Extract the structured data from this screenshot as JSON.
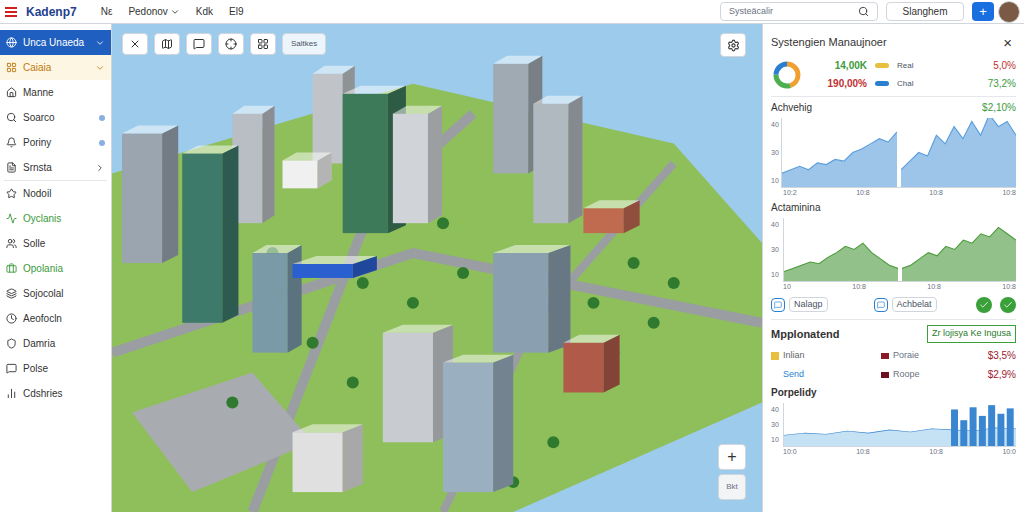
{
  "topbar": {
    "logo": "Kadenp7",
    "menus": [
      {
        "label": "Nε",
        "dropdown": false
      },
      {
        "label": "Pedonov",
        "dropdown": true
      },
      {
        "label": "Kdk",
        "dropdown": false
      },
      {
        "label": "El9",
        "dropdown": false
      }
    ],
    "search": {
      "placeholder": "Systeäcalir"
    },
    "button": "Slanghem",
    "add": "+"
  },
  "sidebar": {
    "items": [
      {
        "label": "Unca Unaeda",
        "selected": true,
        "color": "#ffffff",
        "trailing": "chevron-down",
        "divider_before": false
      },
      {
        "label": "Caiaia",
        "selected": false,
        "color": "#c07a10",
        "trailing": "chevron-down",
        "divider_before": false
      },
      {
        "label": "Manne",
        "selected": false,
        "color": "#333333",
        "trailing": "none",
        "divider_before": false
      },
      {
        "label": "Soarco",
        "selected": false,
        "color": "#333333",
        "trailing": "dot",
        "divider_before": false
      },
      {
        "label": "Poriny",
        "selected": false,
        "color": "#333333",
        "trailing": "dot",
        "divider_before": false
      },
      {
        "label": "Srnsta",
        "selected": false,
        "color": "#333333",
        "trailing": "chevron-right",
        "divider_before": false
      },
      {
        "label": "Nodoil",
        "selected": false,
        "color": "#333333",
        "trailing": "none",
        "divider_before": true
      },
      {
        "label": "Oyclanis",
        "selected": false,
        "color": "#3a9a3a",
        "trailing": "none",
        "divider_before": false
      },
      {
        "label": "Solle",
        "selected": false,
        "color": "#333333",
        "trailing": "none",
        "divider_before": false
      },
      {
        "label": "Opolania",
        "selected": false,
        "color": "#3a9a3a",
        "trailing": "none",
        "divider_before": false
      },
      {
        "label": "Sojocolal",
        "selected": false,
        "color": "#333333",
        "trailing": "none",
        "divider_before": false
      },
      {
        "label": "Aeofocln",
        "selected": false,
        "color": "#333333",
        "trailing": "none",
        "divider_before": false
      },
      {
        "label": "Damria",
        "selected": false,
        "color": "#333333",
        "trailing": "none",
        "divider_before": false
      },
      {
        "label": "Polse",
        "selected": false,
        "color": "#333333",
        "trailing": "none",
        "divider_before": false
      },
      {
        "label": "Cdshries",
        "selected": false,
        "color": "#333333",
        "trailing": "none",
        "divider_before": false
      }
    ]
  },
  "map": {
    "toolbar_button": "Saltkes",
    "zoom_in": "+",
    "bottom_button": "Bkt"
  },
  "panel": {
    "title": "Systengien Manaujnoer",
    "close": "×",
    "donut": [
      {
        "value": 45,
        "color": "#f0a030"
      },
      {
        "value": 30,
        "color": "#4caf50"
      },
      {
        "value": 25,
        "color": "#2a7fd0"
      }
    ],
    "stats": [
      {
        "value": "14,00K",
        "value_color": "#3c9b3c",
        "swatch": "#e8c040",
        "label": "Real",
        "change": "5,0%",
        "change_color": "#c03030"
      },
      {
        "value": "190,00%",
        "value_color": "#c03030",
        "swatch": "#2a7fd0",
        "label": "Chal",
        "change": "73,2%",
        "change_color": "#3c9b3c"
      }
    ],
    "chart1": {
      "title": "Achvehig",
      "value": "$2,10%",
      "y_ticks": [
        "40",
        "30",
        "10"
      ],
      "x_ticks": [
        "10:2",
        "10:8",
        "10:8",
        "10:8"
      ],
      "color": "#5b9fdc",
      "max": 40,
      "panels": [
        [
          8,
          10,
          12,
          10,
          14,
          13,
          16,
          15,
          20,
          22,
          25,
          28,
          26,
          32
        ],
        [
          10,
          15,
          20,
          18,
          30,
          25,
          35,
          28,
          38,
          30,
          42,
          35,
          38,
          30
        ]
      ]
    },
    "chart2": {
      "title": "Actaminina",
      "y_ticks": [
        "40",
        "30",
        "10"
      ],
      "x_ticks": [
        "10",
        "10:8",
        "10:8",
        "10:8"
      ],
      "color": "#4a9a3a",
      "max": 40,
      "panels": [
        [
          6,
          8,
          10,
          12,
          11,
          15,
          18,
          22,
          20,
          24,
          18,
          14,
          10,
          8
        ],
        [
          8,
          10,
          14,
          18,
          16,
          22,
          20,
          26,
          24,
          30,
          28,
          34,
          30,
          26
        ]
      ]
    },
    "actions": [
      {
        "label": "Nalagp"
      },
      {
        "label": "Achbelat"
      }
    ],
    "checks": 2,
    "section": {
      "title": "Mpplonatend",
      "badge": "Zr lojisya Ke Ingusa"
    },
    "legend": [
      {
        "left_label": "Inlian",
        "left_color": "#e8c040",
        "left_swatch": true,
        "right_label": "Poraie",
        "right_color": "#8b1a2a",
        "value": "$3,5%"
      },
      {
        "left_label": "Send",
        "left_color": "#2a7fd0",
        "left_swatch": false,
        "right_label": "Roope",
        "right_color": "#6b1020",
        "value": "$2,9%"
      }
    ],
    "chart3": {
      "title": "Porpelidy",
      "y_ticks": [
        "40",
        "30",
        "10"
      ],
      "x_ticks": [
        "10:0",
        "10:8",
        "10:8",
        "10:0"
      ],
      "color": "#8cc4ea",
      "bar_color": "#3a86d0",
      "max": 40,
      "line": [
        10,
        12,
        11,
        14,
        12,
        15,
        13,
        16,
        15,
        14,
        17,
        16
      ],
      "bars": [
        34,
        24,
        36,
        28,
        38,
        30,
        35
      ]
    }
  }
}
